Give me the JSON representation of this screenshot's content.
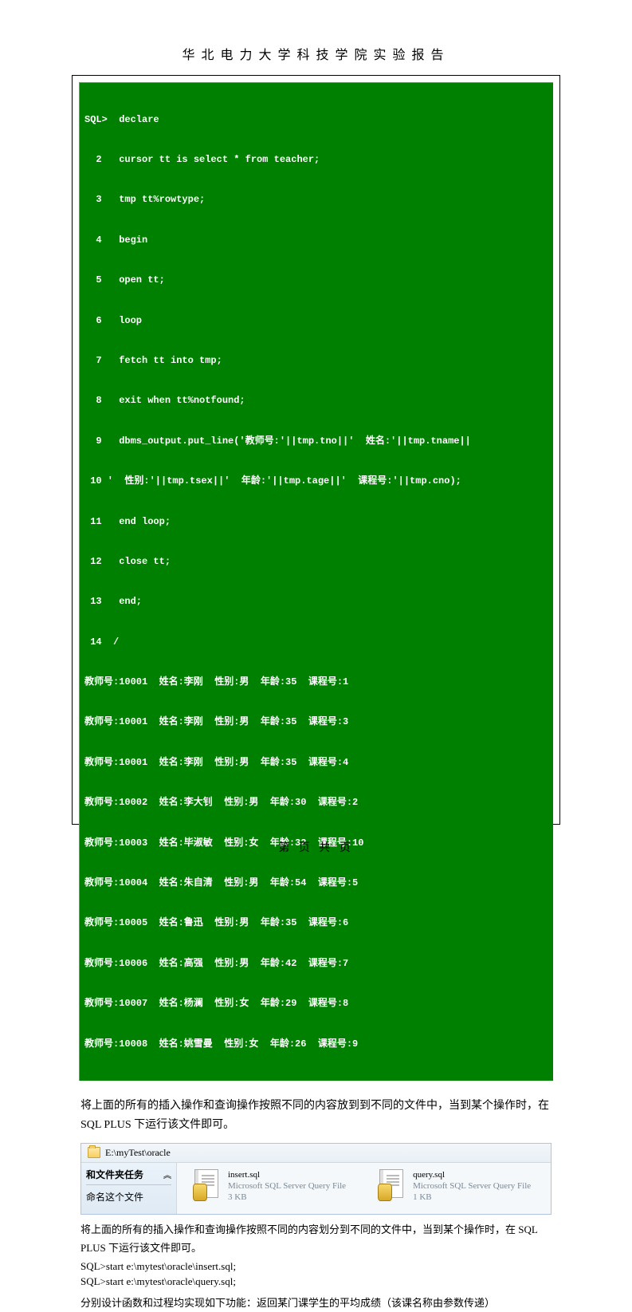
{
  "header": {
    "title": "华北电力大学科技学院实验报告"
  },
  "terminal": {
    "lines": [
      "SQL>  declare",
      "  2   cursor tt is select * from teacher;",
      "  3   tmp tt%rowtype;",
      "  4   begin",
      "  5   open tt;",
      "  6   loop",
      "  7   fetch tt into tmp;",
      "  8   exit when tt%notfound;",
      "  9   dbms_output.put_line('教师号:'||tmp.tno||'  姓名:'||tmp.tname||",
      " 10 '  性别:'||tmp.tsex||'  年龄:'||tmp.tage||'  课程号:'||tmp.cno);",
      " 11   end loop;",
      " 12   close tt;",
      " 13   end;",
      " 14  /",
      "教师号:10001  姓名:李刚  性别:男  年龄:35  课程号:1",
      "教师号:10001  姓名:李刚  性别:男  年龄:35  课程号:3",
      "教师号:10001  姓名:李刚  性别:男  年龄:35  课程号:4",
      "教师号:10002  姓名:李大钊  性别:男  年龄:30  课程号:2",
      "教师号:10003  姓名:毕淑敏  性别:女  年龄:32  课程号:10",
      "教师号:10004  姓名:朱自清  性别:男  年龄:54  课程号:5",
      "教师号:10005  姓名:鲁迅  性别:男  年龄:35  课程号:6",
      "教师号:10006  姓名:高强  性别:男  年龄:42  课程号:7",
      "教师号:10007  姓名:杨澜  性别:女  年龄:29  课程号:8",
      "教师号:10008  姓名:姚雪曼  性别:女  年龄:26  课程号:9"
    ]
  },
  "paragraph1": "将上面的所有的插入操作和查询操作按照不同的内容放到到不同的文件中，当到某个操作时，在 SQL PLUS 下运行该文件即可。",
  "explorer": {
    "path": "E:\\myTest\\oracle",
    "tasks_header": "和文件夹任务",
    "task_item": "命名这个文件",
    "files": [
      {
        "name": "insert.sql",
        "type": "Microsoft SQL Server Query File",
        "size": "3 KB"
      },
      {
        "name": "query.sql",
        "type": "Microsoft SQL Server Query File",
        "size": "1 KB"
      }
    ]
  },
  "paragraph2": "将上面的所有的插入操作和查询操作按照不同的内容划分到不同的文件中，当到某个操作时，在 SQL PLUS 下运行该文件即可。",
  "cmd1": "SQL>start e:\\mytest\\oracle\\insert.sql;",
  "cmd2": "SQL>start e:\\mytest\\oracle\\query.sql;",
  "paragraph3": "分别设计函数和过程均实现如下功能：返回某门课学生的平均成绩（该课名称由参数传递）",
  "footer": "第  页 共  页"
}
